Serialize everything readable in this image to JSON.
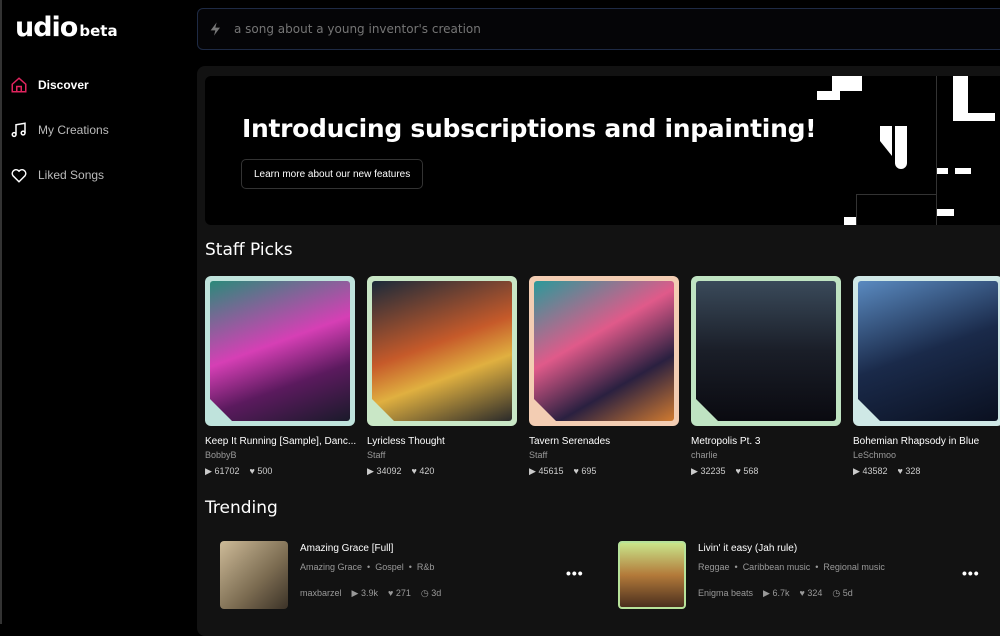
{
  "app": {
    "logo": "udio",
    "logo_badge": "beta"
  },
  "sidebar": {
    "items": [
      {
        "label": "Discover",
        "icon": "home-icon",
        "active": true
      },
      {
        "label": "My Creations",
        "icon": "music-note-icon"
      },
      {
        "label": "Liked Songs",
        "icon": "heart-icon"
      }
    ]
  },
  "search": {
    "placeholder": "a song about a young inventor's creation",
    "icon": "lightning-icon"
  },
  "banner": {
    "title": "Introducing subscriptions and inpainting!",
    "button": "Learn more about our new features"
  },
  "staff_picks": {
    "heading": "Staff Picks",
    "cards": [
      {
        "title": "Keep It Running [Sample], Danc...",
        "author": "BobbyB",
        "plays": "61702",
        "likes": "500",
        "border": "#bfe3dc"
      },
      {
        "title": "Lyricless Thought",
        "author": "Staff",
        "plays": "34092",
        "likes": "420",
        "border": "#c9e7c6"
      },
      {
        "title": "Tavern Serenades",
        "author": "Staff",
        "plays": "45615",
        "likes": "695",
        "border": "#f3cdb3"
      },
      {
        "title": "Metropolis Pt. 3",
        "author": "charlie",
        "plays": "32235",
        "likes": "568",
        "border": "#bfe3c2"
      },
      {
        "title": "Bohemian Rhapsody in Blue",
        "author": "LeSchmoo",
        "plays": "43582",
        "likes": "328",
        "border": "#cfe8e6"
      }
    ]
  },
  "trending": {
    "heading": "Trending",
    "items": [
      {
        "title": "Amazing Grace [Full]",
        "tags": [
          "Amazing Grace",
          "Gospel",
          "R&b"
        ],
        "author": "maxbarzel",
        "plays": "3.9k",
        "likes": "271",
        "age": "3d"
      },
      {
        "title": "Livin' it easy (Jah rule)",
        "tags": [
          "Reggae",
          "Caribbean music",
          "Regional music"
        ],
        "author": "Enigma beats",
        "plays": "6.7k",
        "likes": "324",
        "age": "5d"
      }
    ]
  },
  "colors": {
    "accent": "#e0245e",
    "search_border": "#1e2a44"
  }
}
